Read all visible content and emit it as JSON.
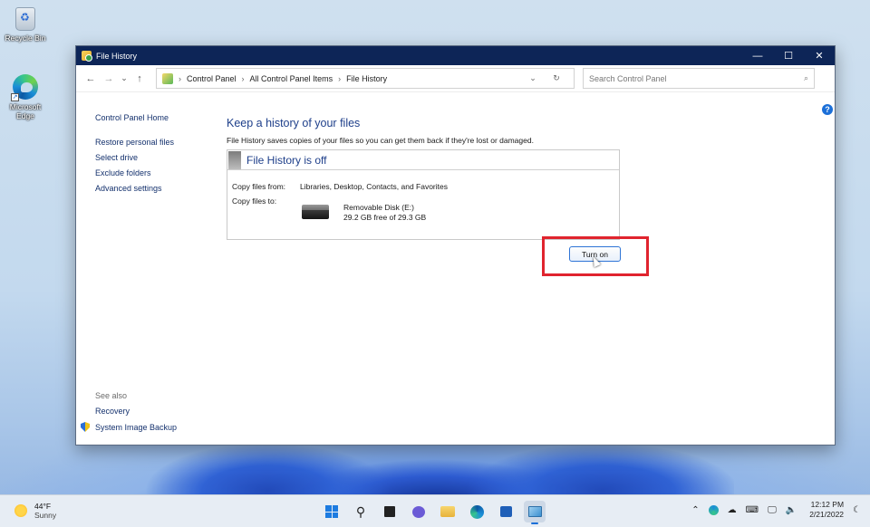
{
  "desktop": {
    "icons": [
      {
        "label": "Recycle Bin"
      },
      {
        "label": "Microsoft Edge"
      }
    ]
  },
  "window": {
    "title": "File History",
    "controls": {
      "minimize": "—",
      "maximize": "☐",
      "close": "✕"
    },
    "nav": {
      "back": "←",
      "forward": "→",
      "recent": "⌄",
      "up": "↑"
    },
    "breadcrumb": [
      "Control Panel",
      "All Control Panel Items",
      "File History"
    ],
    "search": {
      "placeholder": "Search Control Panel"
    }
  },
  "sidebar": {
    "home": "Control Panel Home",
    "tasks": [
      "Restore personal files",
      "Select drive",
      "Exclude folders",
      "Advanced settings"
    ],
    "see_also_header": "See also",
    "see_also": [
      "Recovery",
      "System Image Backup"
    ]
  },
  "main": {
    "heading": "Keep a history of your files",
    "description": "File History saves copies of your files so you can get them back if they're lost or damaged.",
    "status": "File History is off",
    "copy_from_label": "Copy files from:",
    "copy_from_value": "Libraries, Desktop, Contacts, and Favorites",
    "copy_to_label": "Copy files to:",
    "drive_name": "Removable Disk (E:)",
    "drive_space": "29.2 GB free of 29.3 GB",
    "turn_on_button": "Turn on"
  },
  "taskbar": {
    "weather_temp": "44°F",
    "weather_desc": "Sunny",
    "time": "12:12 PM",
    "date": "2/21/2022"
  },
  "colors": {
    "titlebar": "#0d2557",
    "link": "#14316d",
    "heading": "#1e3f8a",
    "highlight_box": "#e0242e"
  }
}
